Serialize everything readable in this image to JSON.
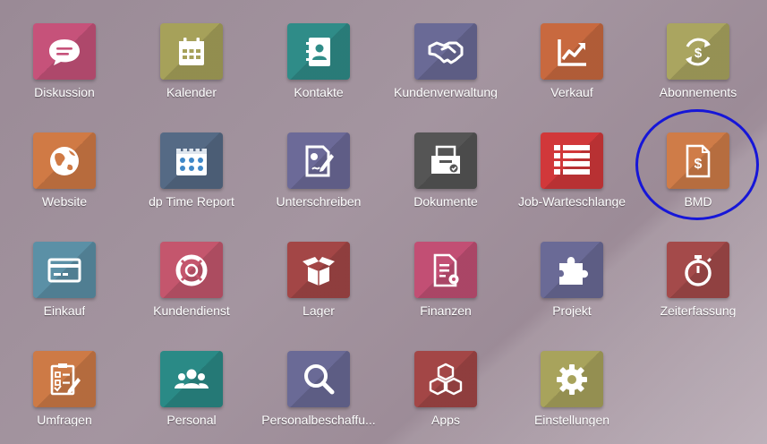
{
  "apps": [
    {
      "label": "Diskussion",
      "icon": "chat-icon",
      "color": "#c6527a"
    },
    {
      "label": "Kalender",
      "icon": "calendar-icon",
      "color": "#a6a15a"
    },
    {
      "label": "Kontakte",
      "icon": "address-book-icon",
      "color": "#2f8c88"
    },
    {
      "label": "Kundenverwaltung",
      "icon": "handshake-icon",
      "color": "#6a6a96"
    },
    {
      "label": "Verkauf",
      "icon": "chart-line-icon",
      "color": "#c8693f"
    },
    {
      "label": "Abonnements",
      "icon": "recurring-dollar-icon",
      "color": "#aaa560"
    },
    {
      "label": "Website",
      "icon": "globe-icon",
      "color": "#d07a45"
    },
    {
      "label": "dp Time Report",
      "icon": "calendar-check-icon",
      "color": "#556a85"
    },
    {
      "label": "Unterschreiben",
      "icon": "sign-document-icon",
      "color": "#6c6a98"
    },
    {
      "label": "Dokumente",
      "icon": "document-tray-icon",
      "color": "#555555"
    },
    {
      "label": "Job-Warteschlange",
      "icon": "list-icon",
      "color": "#d1383a"
    },
    {
      "label": "BMD",
      "icon": "dollar-file-icon",
      "color": "#cf7c48"
    },
    {
      "label": "Einkauf",
      "icon": "credit-card-icon",
      "color": "#5b90a6"
    },
    {
      "label": "Kundendienst",
      "icon": "lifebuoy-icon",
      "color": "#c4566d"
    },
    {
      "label": "Lager",
      "icon": "box-icon",
      "color": "#a34646"
    },
    {
      "label": "Finanzen",
      "icon": "finance-document-icon",
      "color": "#c24f74"
    },
    {
      "label": "Projekt",
      "icon": "puzzle-icon",
      "color": "#6a6a96"
    },
    {
      "label": "Zeiterfassung",
      "icon": "stopwatch-icon",
      "color": "#a44a4a"
    },
    {
      "label": "Umfragen",
      "icon": "checklist-icon",
      "color": "#cd7a46"
    },
    {
      "label": "Personal",
      "icon": "users-icon",
      "color": "#2a8a86"
    },
    {
      "label": "Personalbeschaffu...",
      "icon": "search-icon",
      "color": "#6a6a96"
    },
    {
      "label": "Apps",
      "icon": "cubes-icon",
      "color": "#a34646"
    },
    {
      "label": "Einstellungen",
      "icon": "gear-icon",
      "color": "#a8a35c"
    }
  ]
}
